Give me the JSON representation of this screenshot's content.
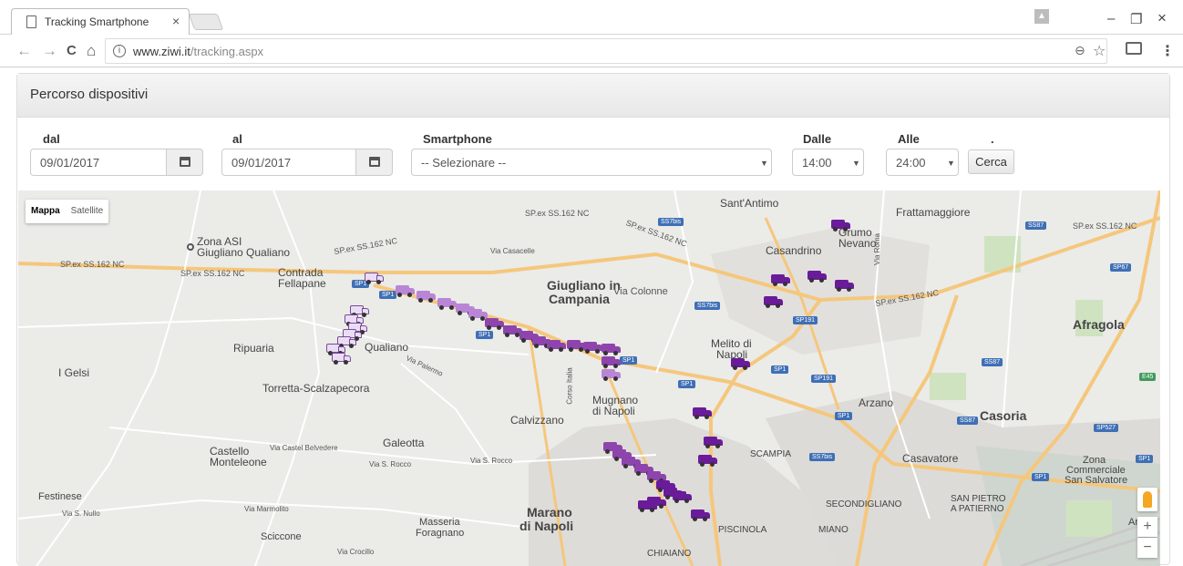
{
  "browser": {
    "tab_title": "Tracking Smartphone",
    "tab_close": "×",
    "url_host": "www.ziwi.it",
    "url_path": "/tracking.aspx",
    "back": "←",
    "forward": "→",
    "reload": "C",
    "home": "⌂",
    "info": "i",
    "minimize": "–",
    "restore": "❐",
    "close": "×",
    "menu": "⋮",
    "zoom": "⊖",
    "star": "☆"
  },
  "panel": {
    "title": "Percorso dispositivi"
  },
  "form": {
    "dal_label": "dal",
    "dal_value": "09/01/2017",
    "al_label": "al",
    "al_value": "09/01/2017",
    "smartphone_label": "Smartphone",
    "smartphone_value": "-- Selezionare --",
    "dalle_label": "Dalle",
    "dalle_value": "14:00",
    "alle_label": "Alle",
    "alle_value": "24:00",
    "dot_label": ".",
    "cerca_label": "Cerca"
  },
  "map": {
    "type_map": "Mappa",
    "type_satellite": "Satellite",
    "zoom_in": "+",
    "zoom_out": "−",
    "colors": {
      "van_dark": "#6a1b9a",
      "van_mid": "#8e44ad",
      "van_light": "#b985d6",
      "van_outline": "#e9ddf3",
      "road_major": "#f7c97a"
    },
    "labels": {
      "zona_asi": "Zona ASI",
      "giugliano_qualiano": "Giugliano Qualiano",
      "contrada": "Contrada",
      "fellapane": "Fellapane",
      "giugliano": "Giugliano in",
      "campania": "Campania",
      "via_colonne": "Via Colonne",
      "sant_antimo": "Sant'Antimo",
      "frattamaggiore": "Frattamaggiore",
      "grumo": "Grumo",
      "nevano": "Nevano",
      "casandrino": "Casandrino",
      "afragola": "Afragola",
      "ripuaria": "Ripuaria",
      "qualiano": "Qualiano",
      "i_gelsi": "I Gelsi",
      "torretta": "Torretta-Scalzapecora",
      "melito": "Melito di",
      "napoli": "Napoli",
      "mugnano": "Mugnano",
      "di_napoli": "di Napoli",
      "calvizzano": "Calvizzano",
      "arzano": "Arzano",
      "casoria": "Casoria",
      "galeotta": "Galeotta",
      "castello": "Castello",
      "monteleone": "Monteleone",
      "via_castel_belvedere": "Via Castel Belvedere",
      "via_s_rocco": "Via S. Rocco",
      "via_s_rocco2": "Via S. Rocco",
      "scampia": "SCAMPIA",
      "casavatore": "Casavatore",
      "zona": "Zona",
      "commerciale": "Commerciale",
      "san_salvatore": "San Salvatore",
      "festinese": "Festinese",
      "via_s_nullo": "Via S. Nullo",
      "via_marmolito": "Via Marmolito",
      "marano": "Marano",
      "di_napoli2": "di Napoli",
      "masseria": "Masseria",
      "foragnano": "Foragnano",
      "sciccone": "Sciccone",
      "via_crocillo": "Via Crocillo",
      "chiaiano": "CHIAIANO",
      "piscinola": "PISCINOLA",
      "miano": "MIANO",
      "secondigliano": "SECONDIGLIANO",
      "san_pietro": "SAN PIETRO",
      "a_patierno": "A PATIERNO",
      "via_casacelle": "Via Casacelle",
      "via_palermo": "Via Palermo",
      "corso_italia": "Corso Italia",
      "via_roma": "Via Roma",
      "ar": "Ar",
      "sp_ex_ss162nc_1": "SP.ex SS.162 NC",
      "sp_ex_ss162nc_2": "SP.ex SS.162 NC",
      "sp_ex_ss162nc_3": "SP.ex SS.162 NC",
      "sp_ex_ss162nc_4": "SP.ex SS.162 NC",
      "sp_ex_ss162nc_5": "SP.ex SS.162 NC",
      "sp_ex_ss162nc_6": "SP.ex SS.162 NC",
      "sp_ex_ss162nc_7": "SP.ex SS.162 NC"
    },
    "shields": [
      "SP1",
      "SP1",
      "SP1",
      "SP1",
      "SP1",
      "SS7bis",
      "SS7bis",
      "SP191",
      "SP191",
      "SP1",
      "SP1",
      "SS87",
      "SS87",
      "SP67",
      "SS87",
      "SS7bis",
      "E45",
      "SP527",
      "SP1",
      "SP1"
    ]
  }
}
